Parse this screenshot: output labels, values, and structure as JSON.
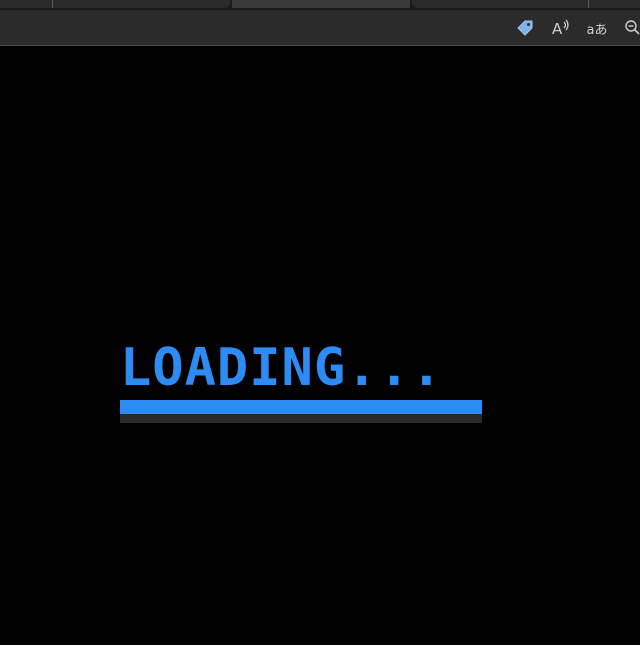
{
  "browser": {
    "tabs": [
      "",
      "",
      ""
    ],
    "toolbar_icons": [
      "tag-icon",
      "read-aloud-icon",
      "translate-icon",
      "zoom-out-icon"
    ],
    "translate_glyph": "aあ",
    "read_aloud_glyph": "A",
    "colors": {
      "toolbar": "#2b2b2b",
      "tabstrip": "#1b1b1b",
      "tag_icon": "#7fb2e6"
    }
  },
  "page": {
    "loading_text": "LOADING...",
    "progress_fraction": 1.0,
    "colors": {
      "background": "#000000",
      "accent": "#2c8cf4",
      "track": "#2a2a2a"
    }
  }
}
